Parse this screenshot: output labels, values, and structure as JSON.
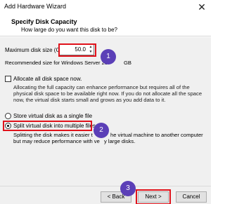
{
  "window": {
    "title": "Add Hardware Wizard",
    "close_glyph": "✕"
  },
  "header": {
    "title": "Specify Disk Capacity",
    "subtitle": "How large do you want this disk to be?"
  },
  "size": {
    "label": "Maximum disk size (GB):",
    "value": "50.0",
    "recommended": "Recommended size for Windows Server 20",
    "recommended_suffix": "GB"
  },
  "allocate": {
    "label": "Allocate all disk space now.",
    "checked": false,
    "description": "Allocating the full capacity can enhance performance but requires all of the physical disk space to be available right now. If you do not allocate all the space now, the virtual disk starts small and grows as you add data to it."
  },
  "storage_options": {
    "single": {
      "label": "Store virtual disk as a single file",
      "selected": false
    },
    "split": {
      "label": "Split virtual disk into multiple files",
      "selected": true
    },
    "split_desc_part1": "Splitting the disk makes it easier t",
    "split_desc_part2": "he virtual machine to another computer",
    "split_desc_line2_a": "but may reduce performance with ve",
    "split_desc_line2_b": "y large disks."
  },
  "buttons": {
    "back": "< Back",
    "next": "Next >",
    "cancel": "Cancel"
  },
  "callouts": {
    "one": "1",
    "two": "2",
    "three": "3"
  },
  "colors": {
    "callout": "#5b3fb7",
    "highlight": "#e0121b"
  }
}
